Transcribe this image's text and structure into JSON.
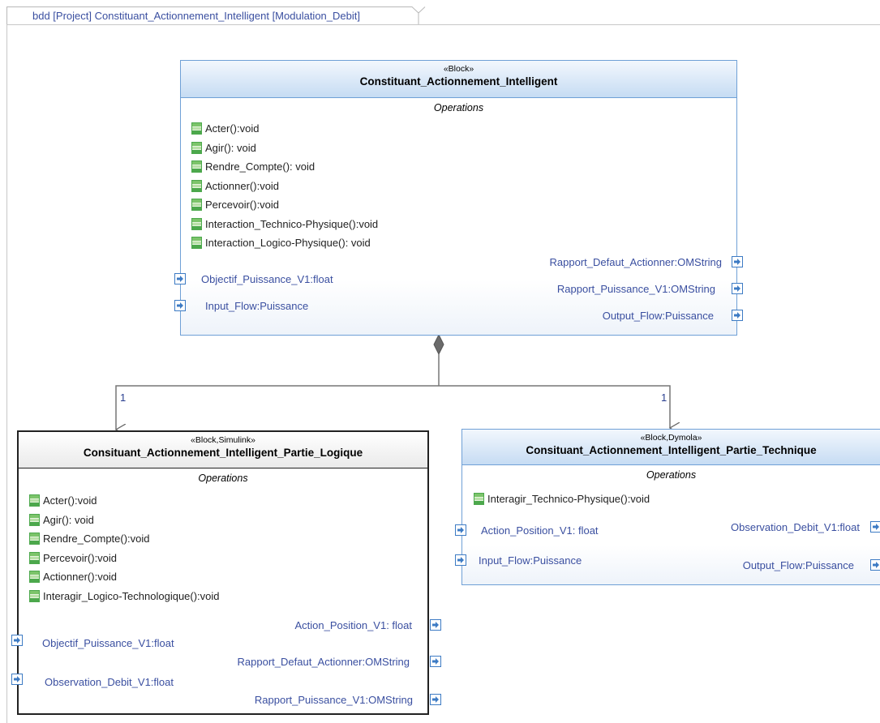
{
  "frame": {
    "title": "bdd [Project] Constituant_Actionnement_Intelligent [Modulation_Debit]"
  },
  "blocks": {
    "top": {
      "stereotype": "«Block»",
      "name": "Constituant_Actionnement_Intelligent",
      "compartment": "Operations",
      "operations": [
        "Acter():void",
        "Agir(): void",
        "Rendre_Compte(): void",
        "Actionner():void",
        "Percevoir():void",
        "Interaction_Technico-Physique():void",
        "Interaction_Logico-Physique(): void"
      ],
      "ports_left": [
        "Objectif_Puissance_V1:float",
        "Input_Flow:Puissance"
      ],
      "ports_right": [
        "Rapport_Defaut_Actionner:OMString",
        "Rapport_Puissance_V1:OMString",
        "Output_Flow:Puissance"
      ]
    },
    "logique": {
      "stereotype": "«Block,Simulink»",
      "name": "Consituant_Actionnement_Intelligent_Partie_Logique",
      "compartment": "Operations",
      "operations": [
        "Acter():void",
        "Agir(): void",
        "Rendre_Compte():void",
        "Percevoir():void",
        "Actionner():void",
        "Interagir_Logico-Technologique():void"
      ],
      "ports_left": [
        "Objectif_Puissance_V1:float",
        "Observation_Debit_V1:float"
      ],
      "ports_right": [
        "Action_Position_V1: float",
        "Rapport_Defaut_Actionner:OMString",
        "Rapport_Puissance_V1:OMString"
      ]
    },
    "technique": {
      "stereotype": "«Block,Dymola»",
      "name": "Consituant_Actionnement_Intelligent_Partie_Technique",
      "compartment": "Operations",
      "operations": [
        "Interagir_Technico-Physique():void"
      ],
      "ports_left": [
        "Action_Position_V1: float",
        "Input_Flow:Puissance"
      ],
      "ports_right": [
        "Observation_Debit_V1:float",
        "Output_Flow:Puissance"
      ]
    }
  },
  "associations": {
    "multiplicity_left": "1",
    "multiplicity_right": "1"
  },
  "colors": {
    "header_blue_top": "#f2f7fd",
    "header_blue_bottom": "#c6dcf3",
    "block_border_blue": "#6fa0d6",
    "logique_border": "#222222",
    "port_border": "#3d7bc4",
    "op_icon_green": "#4ca84c",
    "port_text": "#3a4fa0"
  }
}
